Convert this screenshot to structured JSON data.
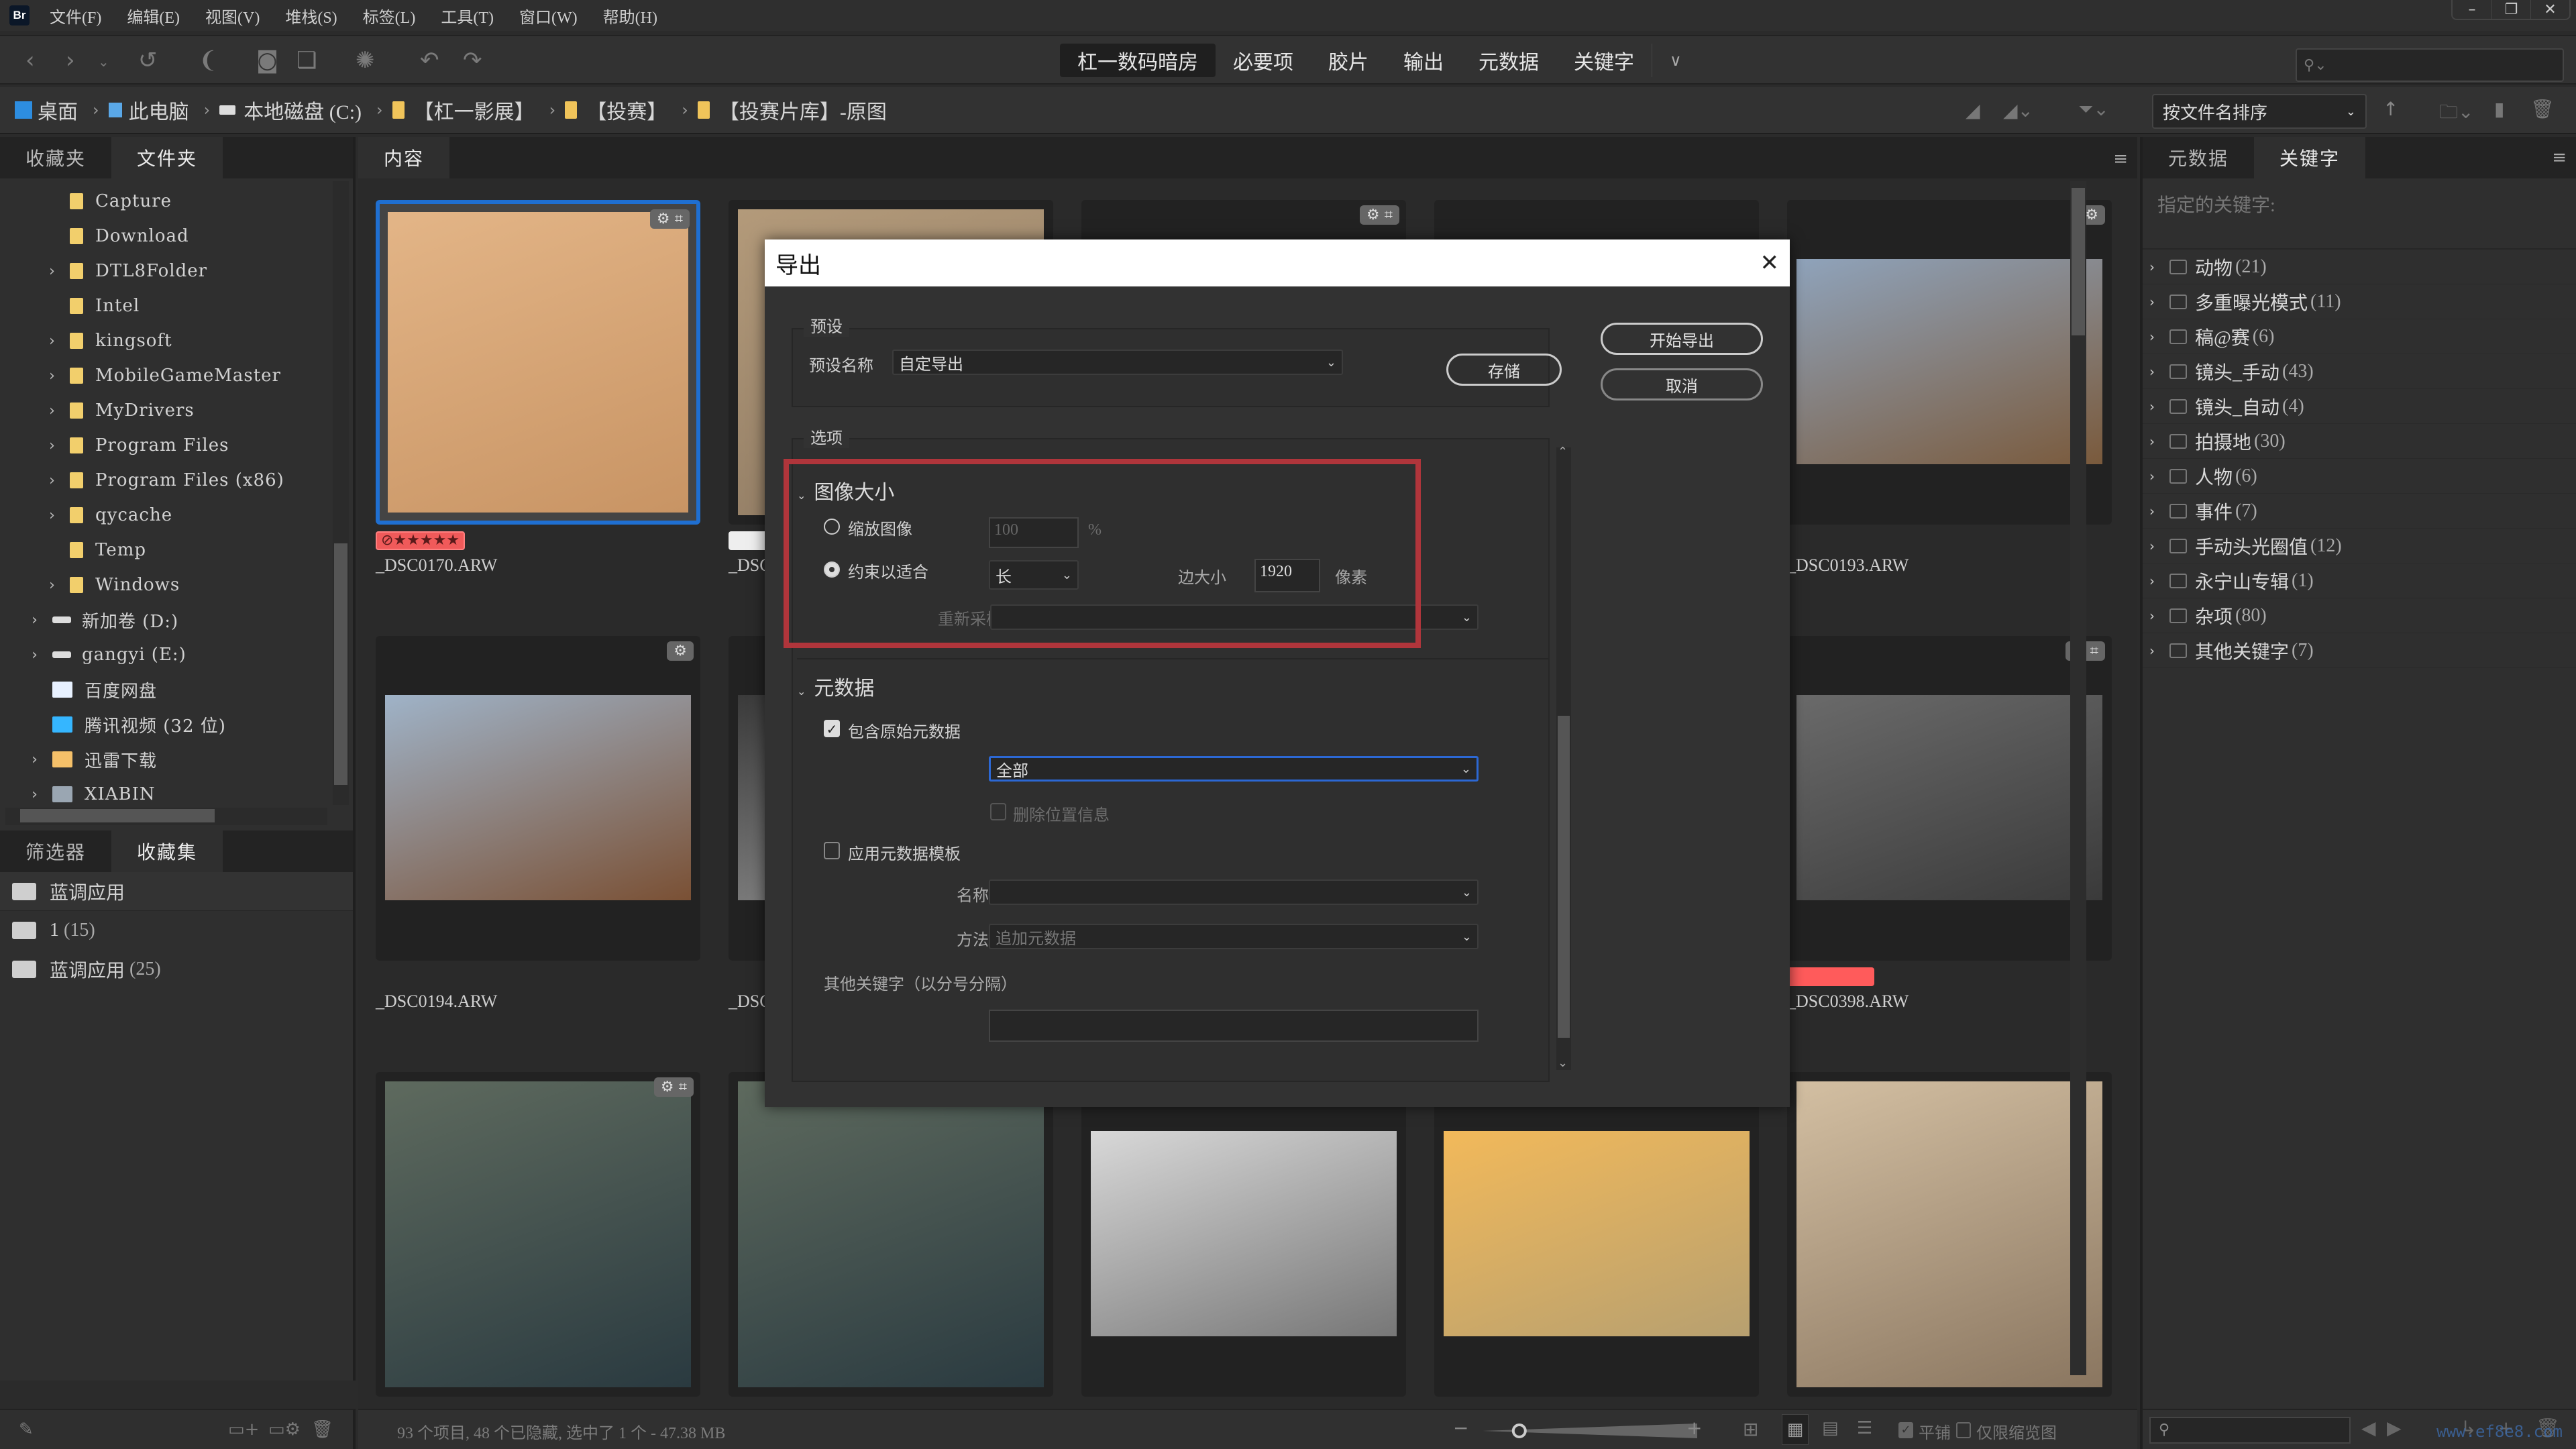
{
  "app": {
    "logo": "Br"
  },
  "menu": [
    "文件(F)",
    "编辑(E)",
    "视图(V)",
    "堆栈(S)",
    "标签(L)",
    "工具(T)",
    "窗口(W)",
    "帮助(H)"
  ],
  "window_controls": {
    "minimize": "–",
    "restore": "❐",
    "close": "✕"
  },
  "workspaces": {
    "items": [
      "杠一数码暗房",
      "必要项",
      "胶片",
      "输出",
      "元数据",
      "关键字"
    ],
    "active": "杠一数码暗房",
    "more": "∨"
  },
  "breadcrumb": [
    {
      "label": "桌面",
      "icon": "desktop-icon"
    },
    {
      "label": "此电脑",
      "icon": "computer-icon"
    },
    {
      "label": "本地磁盘 (C:)",
      "icon": "drive-icon"
    },
    {
      "label": "【杠一影展】",
      "icon": "folder-icon"
    },
    {
      "label": "【投赛】",
      "icon": "folder-icon"
    },
    {
      "label": "【投赛片库】-原图",
      "icon": "folder-icon"
    }
  ],
  "sort": {
    "value": "按文件名排序",
    "direction": "↑"
  },
  "left_panel": {
    "tabs": [
      "收藏夹",
      "文件夹"
    ],
    "active_tab": "文件夹",
    "tree": [
      {
        "label": "Capture",
        "level": 2,
        "expandable": false,
        "type": "folder"
      },
      {
        "label": "Download",
        "level": 2,
        "expandable": false,
        "type": "folder"
      },
      {
        "label": "DTL8Folder",
        "level": 2,
        "expandable": true,
        "type": "folder"
      },
      {
        "label": "Intel",
        "level": 2,
        "expandable": false,
        "type": "folder"
      },
      {
        "label": "kingsoft",
        "level": 2,
        "expandable": true,
        "type": "folder"
      },
      {
        "label": "MobileGameMaster",
        "level": 2,
        "expandable": true,
        "type": "folder"
      },
      {
        "label": "MyDrivers",
        "level": 2,
        "expandable": true,
        "type": "folder"
      },
      {
        "label": "Program Files",
        "level": 2,
        "expandable": true,
        "type": "folder"
      },
      {
        "label": "Program Files (x86)",
        "level": 2,
        "expandable": true,
        "type": "folder"
      },
      {
        "label": "qycache",
        "level": 2,
        "expandable": true,
        "type": "folder"
      },
      {
        "label": "Temp",
        "level": 2,
        "expandable": false,
        "type": "folder"
      },
      {
        "label": "Windows",
        "level": 2,
        "expandable": true,
        "type": "folder"
      },
      {
        "label": "新加卷 (D:)",
        "level": 1,
        "expandable": true,
        "type": "drive"
      },
      {
        "label": "gangyi (E:)",
        "level": 1,
        "expandable": true,
        "type": "drive"
      },
      {
        "label": "百度网盘",
        "level": 1,
        "expandable": false,
        "type": "baidu"
      },
      {
        "label": "腾讯视频 (32 位)",
        "level": 1,
        "expandable": false,
        "type": "tencent"
      },
      {
        "label": "迅雷下载",
        "level": 1,
        "expandable": true,
        "type": "xunlei"
      },
      {
        "label": "XIABIN",
        "level": 1,
        "expandable": true,
        "type": "network"
      }
    ]
  },
  "collections_panel": {
    "tabs": [
      "筛选器",
      "收藏集"
    ],
    "active_tab": "收藏集",
    "items": [
      {
        "label": "蓝调应用",
        "count": "",
        "smart": true
      },
      {
        "label": "1",
        "count": "(15)",
        "smart": false
      },
      {
        "label": "蓝调应用",
        "count": "(25)",
        "smart": false
      }
    ]
  },
  "content": {
    "tab": "内容",
    "thumbnails": [
      {
        "name": "_DSC0170.ARW",
        "selected": true,
        "rating": "⊘★★★★★",
        "label": "red",
        "badge": "⚙ ⌗",
        "colors": [
          "#e3b587",
          "#c89464"
        ]
      },
      {
        "name": "_DSC",
        "selected": false,
        "label": "white",
        "badge": "",
        "colors": [
          "#b39a7a",
          "#8d7962"
        ]
      },
      {
        "name": "",
        "selected": false,
        "badge": "⚙ ⌗",
        "colors": [
          "#cfc6a8",
          "#8d8a72"
        ]
      },
      {
        "name": "",
        "selected": false,
        "badge": "",
        "colors": [
          "#2a2a2a",
          "#2a2a2a"
        ]
      },
      {
        "name": "_DSC0193.ARW",
        "selected": false,
        "badge": "⚙",
        "colors": [
          "#8fa3bb",
          "#7a5a3c"
        ]
      },
      {
        "name": "_DSC0194.ARW",
        "selected": false,
        "badge": "⚙",
        "colors": [
          "#9fb3c8",
          "#7a5034"
        ]
      },
      {
        "name": "_DSC",
        "selected": false,
        "badge": "",
        "colors": [
          "#3a3a3a",
          "#9a9a9a"
        ]
      },
      {
        "name": "",
        "selected": false,
        "badge": "",
        "colors": [
          "#2a2a2a",
          "#2a2a2a"
        ]
      },
      {
        "name": "",
        "selected": false,
        "badge": "",
        "colors": [
          "#2a2a2a",
          "#2a2a2a"
        ]
      },
      {
        "name": "_DSC0398.ARW",
        "selected": false,
        "label": "red",
        "badge": "⚙ ⌗",
        "colors": [
          "#6a6a6a",
          "#3a3a3a"
        ]
      },
      {
        "name": "",
        "selected": false,
        "badge": "⚙ ⌗",
        "colors": [
          "#5e6a5e",
          "#2a3a40"
        ]
      },
      {
        "name": "",
        "selected": false,
        "badge": "",
        "colors": [
          "#5e6a5e",
          "#2a3a40"
        ]
      },
      {
        "name": "",
        "selected": false,
        "badge": "",
        "colors": [
          "#d8d8d8",
          "#777"
        ]
      },
      {
        "name": "",
        "selected": false,
        "badge": "",
        "colors": [
          "#f2b95a",
          "#b7a070"
        ]
      },
      {
        "name": "",
        "selected": false,
        "badge": "",
        "colors": [
          "#d3bfa2",
          "#8a7660"
        ]
      }
    ]
  },
  "status": {
    "text": "93 个项目, 48 个已隐藏, 选中了 1 个 - 47.38 MB",
    "thumb_size_fraction": 0.22,
    "tile_label": "平铺",
    "tile_checked": true,
    "thumb_only_label": "仅限缩览图",
    "thumb_only_checked": false
  },
  "right_panel": {
    "tabs": [
      "元数据",
      "关键字"
    ],
    "active_tab": "关键字",
    "assigned_label": "指定的关键字:",
    "keywords": [
      {
        "label": "动物",
        "count": "(21)"
      },
      {
        "label": "多重曝光模式",
        "count": "(11)"
      },
      {
        "label": "稿@赛",
        "count": "(6)"
      },
      {
        "label": "镜头_手动",
        "count": "(43)"
      },
      {
        "label": "镜头_自动",
        "count": "(4)"
      },
      {
        "label": "拍摄地",
        "count": "(30)"
      },
      {
        "label": "人物",
        "count": "(6)"
      },
      {
        "label": "事件",
        "count": "(7)"
      },
      {
        "label": "手动头光圈值",
        "count": "(12)"
      },
      {
        "label": "永宁山专辑",
        "count": "(1)"
      },
      {
        "label": "杂项",
        "count": "(80)"
      },
      {
        "label": "其他关键字",
        "count": "(7)"
      }
    ],
    "watermark": "www.ef8e8.com"
  },
  "dialog": {
    "title": "导出",
    "close": "✕",
    "preset_legend": "预设",
    "preset_name_label": "预设名称",
    "preset_value": "自定导出",
    "save_button": "存储",
    "start_button": "开始导出",
    "cancel_button": "取消",
    "options_legend": "选项",
    "image_size": {
      "heading": "图像大小",
      "scale_label": "缩放图像",
      "scale_value": "100",
      "scale_unit": "%",
      "scale_selected": false,
      "constrain_label": "约束以适合",
      "constrain_selected": true,
      "side_value": "长",
      "side_label": "边大小",
      "size_value": "1920",
      "size_unit": "像素",
      "resample_label": "重新采样方法",
      "resample_value": ""
    },
    "metadata": {
      "heading": "元数据",
      "include_original_label": "包含原始元数据",
      "include_original_checked": true,
      "include_value": "全部",
      "remove_location_label": "删除位置信息",
      "remove_location_checked": false,
      "apply_template_label": "应用元数据模板",
      "apply_template_checked": false,
      "name_label": "名称",
      "name_value": "",
      "method_label": "方法",
      "method_value": "追加元数据",
      "other_keywords_label": "其他关键字（以分号分隔）",
      "other_keywords_value": ""
    },
    "highlight_color": "#b0353b"
  }
}
